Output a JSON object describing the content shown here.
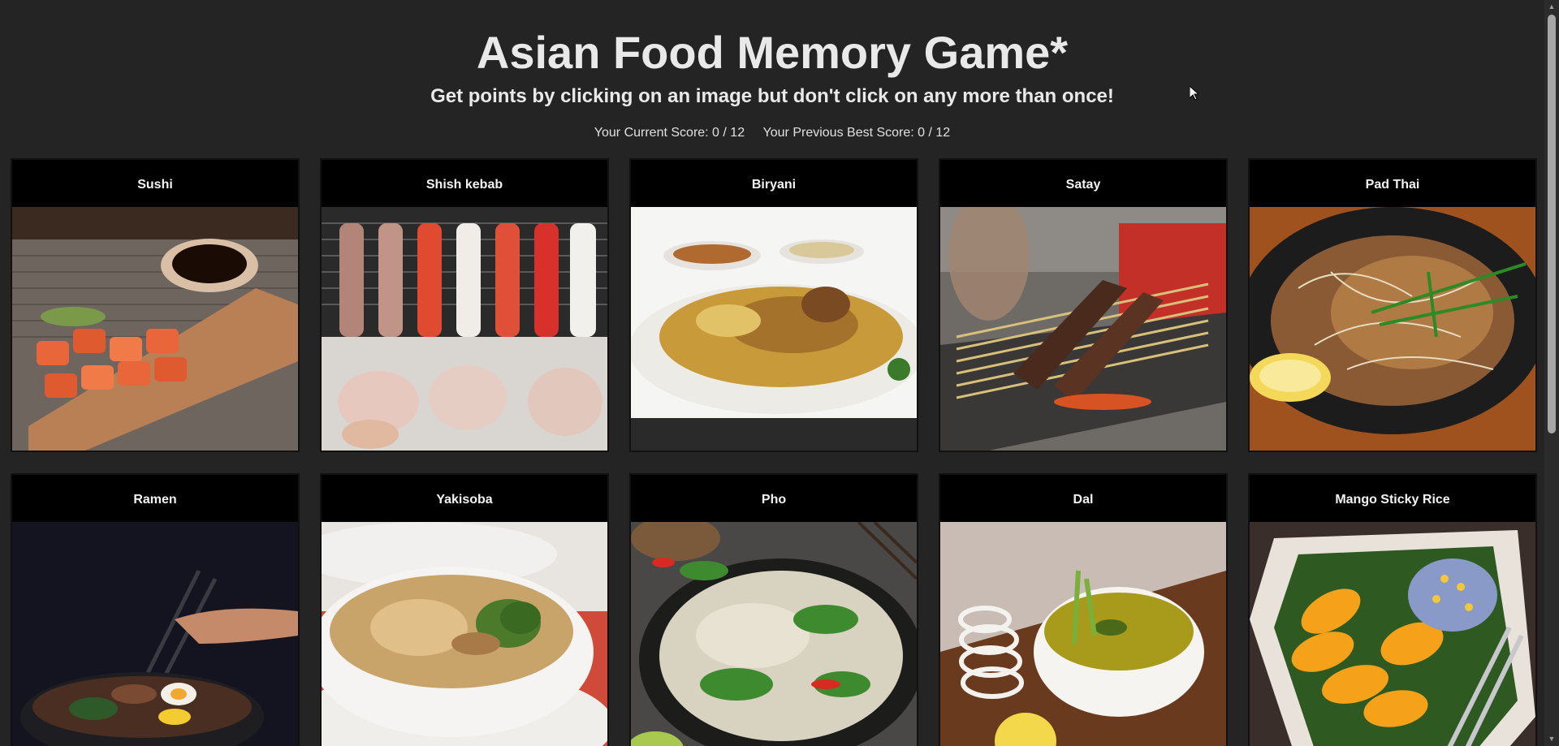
{
  "header": {
    "title": "Asian Food Memory Game*",
    "subtitle": "Get points by clicking on an image but don't click on any more than once!",
    "current_score": "Your Current Score: 0 / 12",
    "best_score": "Your Previous Best Score: 0 / 12"
  },
  "cards": [
    {
      "label": "Sushi",
      "image": "sushi-photo"
    },
    {
      "label": "Shish kebab",
      "image": "shish-kebab-photo"
    },
    {
      "label": "Biryani",
      "image": "biryani-photo"
    },
    {
      "label": "Satay",
      "image": "satay-photo"
    },
    {
      "label": "Pad Thai",
      "image": "pad-thai-photo"
    },
    {
      "label": "Ramen",
      "image": "ramen-photo"
    },
    {
      "label": "Yakisoba",
      "image": "yakisoba-photo"
    },
    {
      "label": "Pho",
      "image": "pho-photo"
    },
    {
      "label": "Dal",
      "image": "dal-photo"
    },
    {
      "label": "Mango Sticky Rice",
      "image": "mango-sticky-rice-photo"
    }
  ],
  "colors": {
    "background": "#242424",
    "card_background": "#000000",
    "text": "#e9e9e9"
  }
}
